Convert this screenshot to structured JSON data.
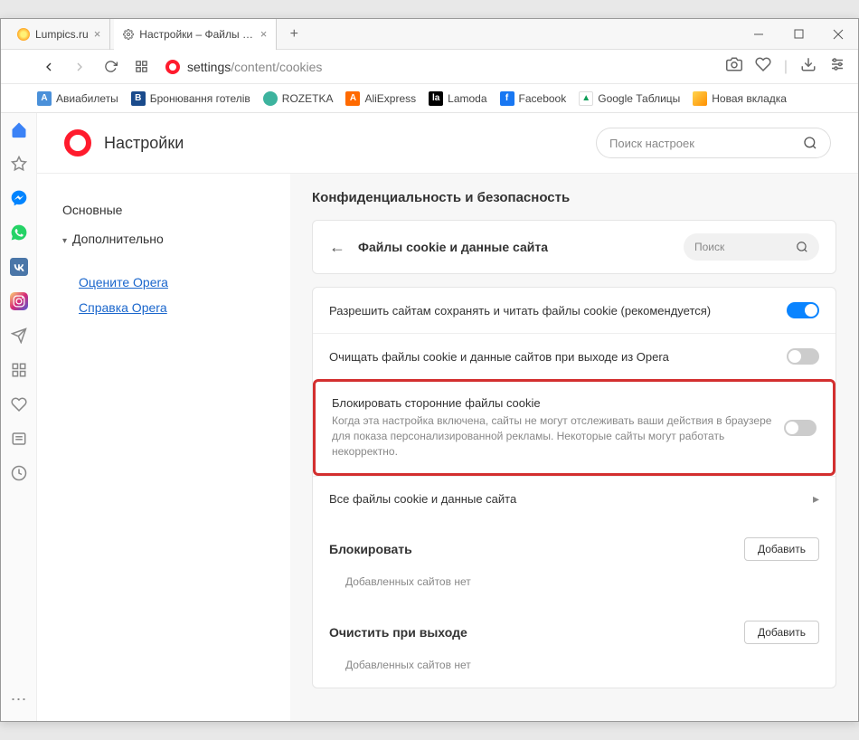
{
  "tabs": [
    {
      "title": "Lumpics.ru"
    },
    {
      "title": "Настройки – Файлы cookie"
    }
  ],
  "address": {
    "prefix": "settings",
    "path": "/content/cookies"
  },
  "bookmarks": [
    {
      "label": "Авиабилеты",
      "color": "#4a90d9",
      "letter": "A"
    },
    {
      "label": "Бронювання готелів",
      "color": "#1a4b8c",
      "letter": "B"
    },
    {
      "label": "ROZETKA",
      "color": "#3db39e",
      "letter": ""
    },
    {
      "label": "AliExpress",
      "color": "#ff6a00",
      "letter": "A"
    },
    {
      "label": "Lamoda",
      "color": "#000",
      "letter": "la"
    },
    {
      "label": "Facebook",
      "color": "#1877f2",
      "letter": "f"
    },
    {
      "label": "Google Таблицы",
      "color": "#0f9d58",
      "letter": "▲"
    },
    {
      "label": "Новая вкладка",
      "color": "#f5c518",
      "letter": ""
    }
  ],
  "settings_title": "Настройки",
  "header_search_placeholder": "Поиск настроек",
  "left_nav": {
    "main": "Основные",
    "advanced": "Дополнительно",
    "rate": "Оцените Opera",
    "help": "Справка Opera"
  },
  "section_title": "Конфиденциальность и безопасность",
  "card_header": "Файлы cookie и данные сайта",
  "card_search_placeholder": "Поиск",
  "rows": {
    "allow": "Разрешить сайтам сохранять и читать файлы cookie (рекомендуется)",
    "clear_on_exit": "Очищать файлы cookie и данные сайтов при выходе из Opera",
    "block_third_title": "Блокировать сторонние файлы cookie",
    "block_third_desc": "Когда эта настройка включена, сайты не могут отслеживать ваши действия в браузере для показа персонализированной рекламы. Некоторые сайты могут работать некорректно.",
    "all_cookies": "Все файлы cookie и данные сайта"
  },
  "block_section": "Блокировать",
  "clear_section": "Очистить при выходе",
  "add_button": "Добавить",
  "empty_text": "Добавленных сайтов нет"
}
